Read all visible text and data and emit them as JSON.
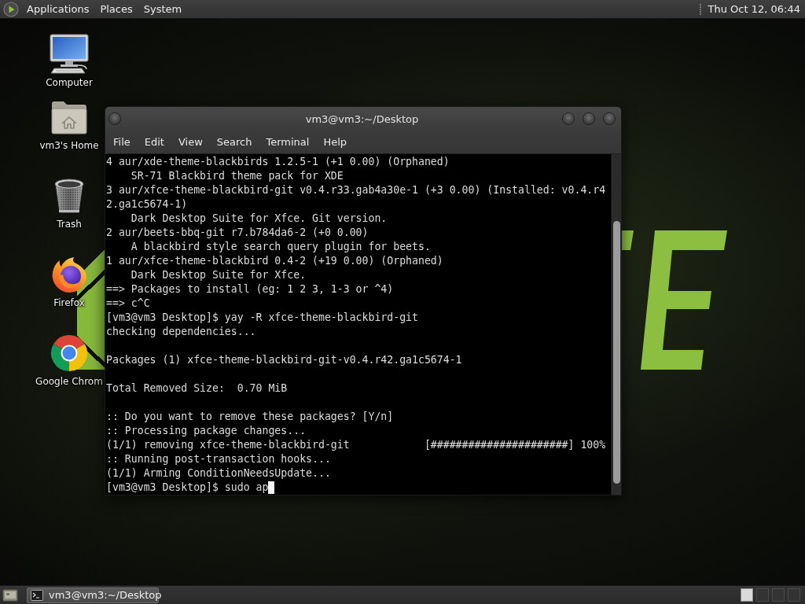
{
  "top_panel": {
    "menus": [
      "Applications",
      "Places",
      "System"
    ],
    "clock": "Thu Oct 12, 06:44"
  },
  "desktop_icons": [
    {
      "kind": "monitor",
      "label": "Computer"
    },
    {
      "kind": "folder",
      "label": "vm3's Home"
    },
    {
      "kind": "trash",
      "label": "Trash"
    },
    {
      "kind": "flame_globe",
      "label": "Firefox"
    },
    {
      "kind": "ring",
      "label": "Google Chrom"
    }
  ],
  "terminal_window": {
    "title": "vm3@vm3:~/Desktop",
    "menu": [
      "File",
      "Edit",
      "View",
      "Search",
      "Terminal",
      "Help"
    ],
    "output_blocks": [
      [
        "4 aur/xde-theme-blackbirds 1.2.5-1 (+1 0.00) (Orphaned)",
        "    SR-71 Blackbird theme pack for XDE",
        "3 aur/xfce-theme-blackbird-git v0.4.r33.gab4a30e-1 (+3 0.00) (Installed: v0.4.r4",
        "2.ga1c5674-1)",
        "    Dark Desktop Suite for Xfce. Git version.",
        "2 aur/beets-bbq-git r7.b784da6-2 (+0 0.00)",
        "    A blackbird style search query plugin for beets.",
        "1 aur/xfce-theme-blackbird 0.4-2 (+19 0.00) (Orphaned)",
        "    Dark Desktop Suite for Xfce.",
        "==> Packages to install (eg: 1 2 3, 1-3 or ^4)",
        "==> c^C",
        "[vm3@vm3 Desktop]$ yay -R xfce-theme-blackbird-git",
        "checking dependencies..."
      ],
      [
        "Packages (1) xfce-theme-blackbird-git-v0.4.r42.ga1c5674-1"
      ],
      [
        "Total Removed Size:  0.70 MiB"
      ],
      [
        ":: Do you want to remove these packages? [Y/n]",
        ":: Processing package changes...",
        "(1/1) removing xfce-theme-blackbird-git            [######################] 100%",
        ":: Running post-transaction hooks...",
        "(1/1) Arming ConditionNeedsUpdate...",
        "[vm3@vm3 Desktop]$ sudo ap"
      ]
    ]
  },
  "bottom_panel": {
    "tasks": [
      {
        "label": "vm3@vm3:~/Desktop",
        "selected": true
      }
    ],
    "workspaces": [
      {
        "selected": true
      },
      {
        "selected": false
      },
      {
        "selected": false
      },
      {
        "selected": false
      }
    ]
  }
}
